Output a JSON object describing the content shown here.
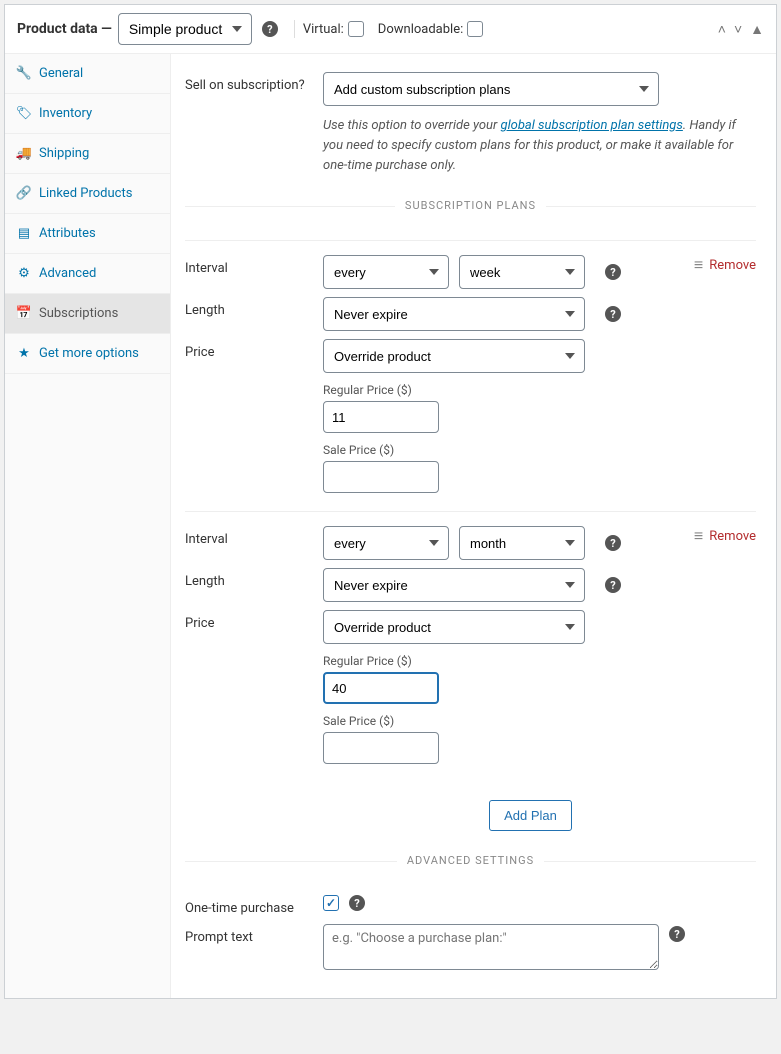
{
  "header": {
    "title": "Product data —",
    "product_type": "Simple product",
    "virtual_label": "Virtual:",
    "downloadable_label": "Downloadable:"
  },
  "tabs": {
    "general": "General",
    "inventory": "Inventory",
    "shipping": "Shipping",
    "linked": "Linked Products",
    "attributes": "Attributes",
    "advanced": "Advanced",
    "subscriptions": "Subscriptions",
    "more": "Get more options"
  },
  "sell_on": {
    "label": "Sell on subscription?",
    "value": "Add custom subscription plans",
    "desc_before": "Use this option to override your ",
    "desc_link": "global subscription plan settings",
    "desc_after": ". Handy if you need to specify custom plans for this product, or make it available for one-time purchase only."
  },
  "section_plans_title": "SUBSCRIPTION PLANS",
  "remove_label": "Remove",
  "labels": {
    "interval": "Interval",
    "length": "Length",
    "price": "Price",
    "regular_price": "Regular Price ($)",
    "sale_price": "Sale Price ($)"
  },
  "plan1": {
    "interval_a": "every",
    "interval_b": "week",
    "length": "Never expire",
    "price_mode": "Override product",
    "regular": "11",
    "sale": ""
  },
  "plan2": {
    "interval_a": "every",
    "interval_b": "month",
    "length": "Never expire",
    "price_mode": "Override product",
    "regular": "40",
    "sale": ""
  },
  "add_plan_label": "Add Plan",
  "section_advanced_title": "ADVANCED SETTINGS",
  "adv": {
    "onetime_label": "One-time purchase",
    "prompt_label": "Prompt text",
    "prompt_placeholder": "e.g. \"Choose a purchase plan:\""
  }
}
